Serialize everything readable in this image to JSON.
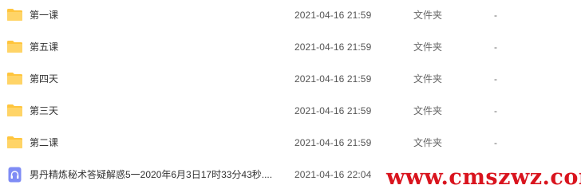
{
  "files": [
    {
      "name": "第一课",
      "date": "2021-04-16 21:59",
      "type": "文件夹",
      "size": "-",
      "icon": "folder-icon"
    },
    {
      "name": "第五课",
      "date": "2021-04-16 21:59",
      "type": "文件夹",
      "size": "-",
      "icon": "folder-icon"
    },
    {
      "name": "第四天",
      "date": "2021-04-16 21:59",
      "type": "文件夹",
      "size": "-",
      "icon": "folder-icon"
    },
    {
      "name": "第三天",
      "date": "2021-04-16 21:59",
      "type": "文件夹",
      "size": "-",
      "icon": "folder-icon"
    },
    {
      "name": "第二课",
      "date": "2021-04-16 21:59",
      "type": "文件夹",
      "size": "-",
      "icon": "folder-icon"
    },
    {
      "name": "男丹精炼秘术答疑解惑5一2020年6月3日17时33分43秒....",
      "date": "2021-04-16 22:04",
      "type": "",
      "size": "",
      "icon": "audio-file-icon"
    }
  ],
  "watermark": {
    "text": "www.cmszwz.com"
  },
  "colors": {
    "folder": "#ffc53d",
    "audio": "#7f8cf5",
    "watermark": "#d9141e"
  }
}
